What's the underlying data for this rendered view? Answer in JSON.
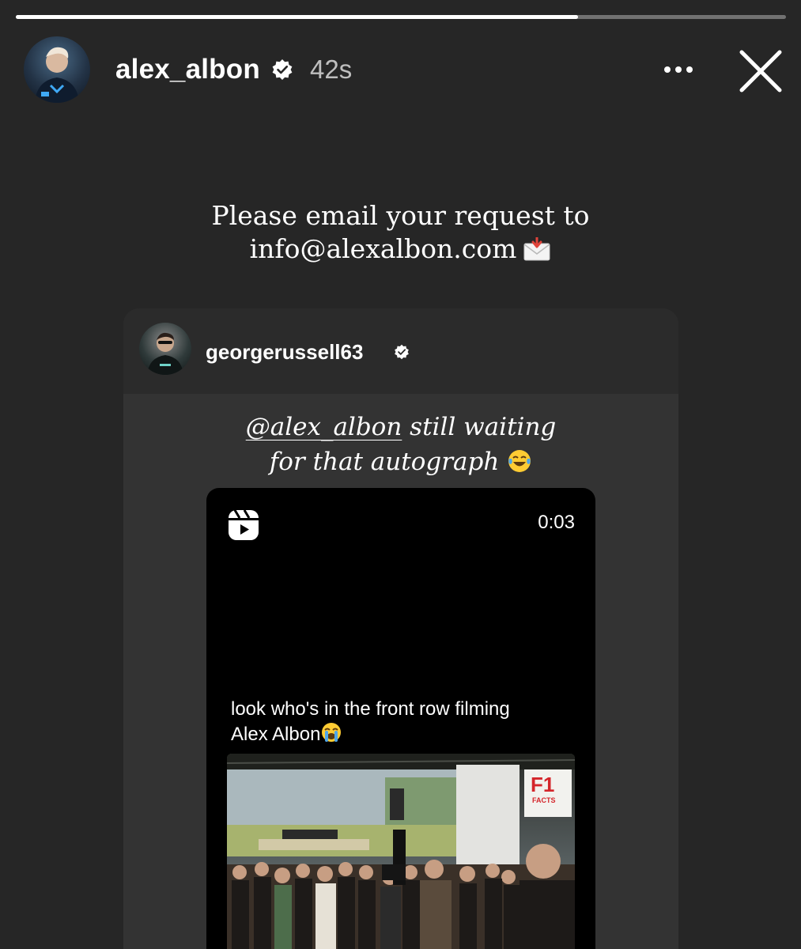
{
  "story": {
    "progress": 0.73
  },
  "header": {
    "username": "alex_albon",
    "timestamp": "42s"
  },
  "caption": {
    "line1": "Please email your request to",
    "line2": "info@alexalbon.com"
  },
  "shared_post": {
    "username": "georgerussell63",
    "caption_mention": "@alex_albon",
    "caption_rest_line1": " still waiting",
    "caption_line2": "for that autograph",
    "video": {
      "duration": "0:03",
      "overlay_line1": "look who's in the front row filming",
      "overlay_line2": "Alex Albon",
      "frame_sign_text": "F1",
      "frame_sign_subtext": "FACTS"
    }
  },
  "colors": {
    "background": "#262626",
    "card": "#333333",
    "text": "#ffffff"
  },
  "icons": [
    "verified-badge-icon",
    "more-options-icon",
    "close-icon",
    "incoming-envelope-icon",
    "reels-icon",
    "loudly-crying-face-icon",
    "face-with-tears-of-joy-icon"
  ]
}
